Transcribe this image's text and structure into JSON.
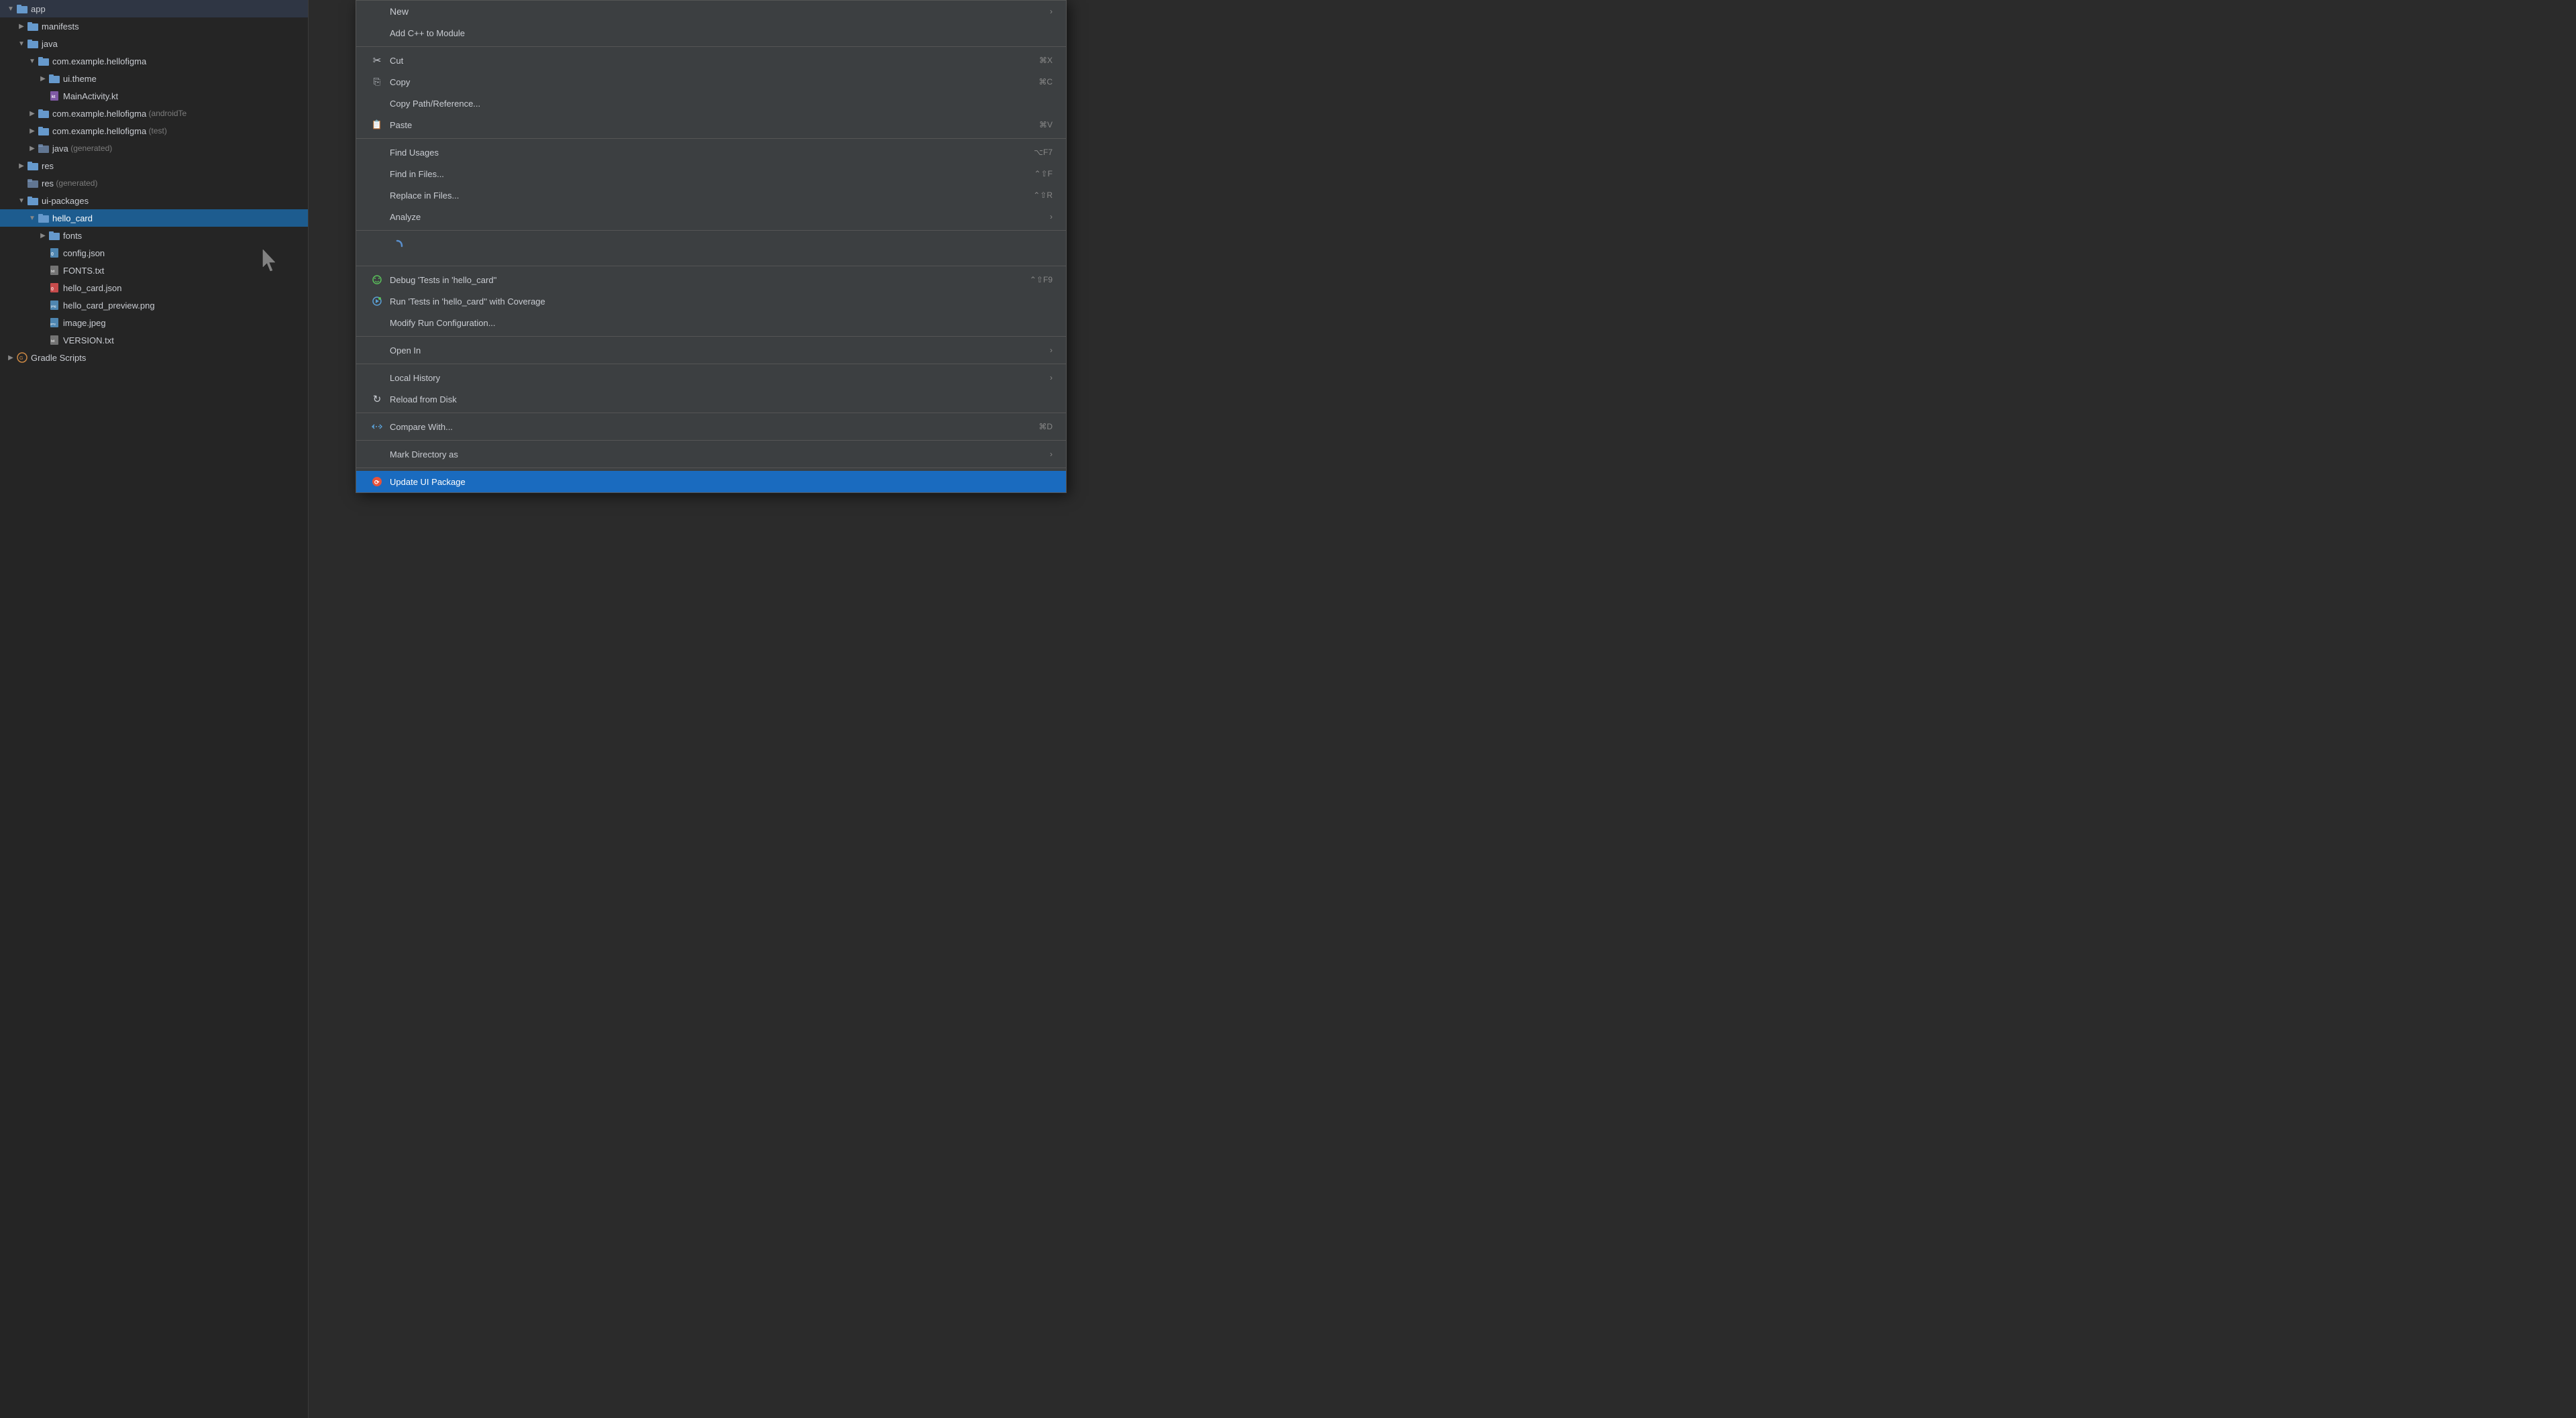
{
  "fileTree": {
    "items": [
      {
        "id": "app",
        "label": "app",
        "indent": 0,
        "type": "folder",
        "arrow": "expanded",
        "iconColor": "blue",
        "selected": false
      },
      {
        "id": "manifests",
        "label": "manifests",
        "indent": 1,
        "type": "folder",
        "arrow": "collapsed",
        "iconColor": "blue",
        "selected": false
      },
      {
        "id": "java",
        "label": "java",
        "indent": 1,
        "type": "folder",
        "arrow": "expanded",
        "iconColor": "blue",
        "selected": false
      },
      {
        "id": "com.example.hellofigma",
        "label": "com.example.hellofigma",
        "indent": 2,
        "type": "folder",
        "arrow": "expanded",
        "iconColor": "blue",
        "selected": false
      },
      {
        "id": "ui.theme",
        "label": "ui.theme",
        "indent": 3,
        "type": "folder",
        "arrow": "collapsed",
        "iconColor": "blue",
        "selected": false
      },
      {
        "id": "MainActivity.kt",
        "label": "MainActivity.kt",
        "indent": 3,
        "type": "file-kt",
        "arrow": "empty",
        "selected": false
      },
      {
        "id": "com.example.hellofigma-androidTest",
        "label": "com.example.hellofigma",
        "suffix": "(androidTe",
        "indent": 2,
        "type": "folder",
        "arrow": "collapsed",
        "iconColor": "blue",
        "selected": false
      },
      {
        "id": "com.example.hellofigma-test",
        "label": "com.example.hellofigma",
        "suffix": "(test)",
        "indent": 2,
        "type": "folder",
        "arrow": "collapsed",
        "iconColor": "blue",
        "selected": false
      },
      {
        "id": "java-generated",
        "label": "java",
        "suffix": "(generated)",
        "indent": 2,
        "type": "folder-generated",
        "arrow": "collapsed",
        "iconColor": "blue",
        "selected": false
      },
      {
        "id": "res",
        "label": "res",
        "indent": 1,
        "type": "folder",
        "arrow": "collapsed",
        "iconColor": "blue",
        "selected": false
      },
      {
        "id": "res-generated",
        "label": "res",
        "suffix": "(generated)",
        "indent": 1,
        "type": "folder-generated",
        "arrow": "empty",
        "iconColor": "blue",
        "selected": false
      },
      {
        "id": "ui-packages",
        "label": "ui-packages",
        "indent": 1,
        "type": "folder",
        "arrow": "expanded",
        "iconColor": "blue",
        "selected": false
      },
      {
        "id": "hello_card",
        "label": "hello_card",
        "indent": 2,
        "type": "folder",
        "arrow": "expanded",
        "iconColor": "blue",
        "selected": true
      },
      {
        "id": "fonts",
        "label": "fonts",
        "indent": 3,
        "type": "folder",
        "arrow": "collapsed",
        "iconColor": "blue",
        "selected": false
      },
      {
        "id": "config.json",
        "label": "config.json",
        "indent": 3,
        "type": "file-json-blue",
        "arrow": "empty",
        "selected": false
      },
      {
        "id": "FONTS.txt",
        "label": "FONTS.txt",
        "indent": 3,
        "type": "file-txt",
        "arrow": "empty",
        "selected": false
      },
      {
        "id": "hello_card.json",
        "label": "hello_card.json",
        "indent": 3,
        "type": "file-json-red",
        "arrow": "empty",
        "selected": false
      },
      {
        "id": "hello_card_preview.png",
        "label": "hello_card_preview.png",
        "indent": 3,
        "type": "file-png",
        "arrow": "empty",
        "selected": false
      },
      {
        "id": "image.jpeg",
        "label": "image.jpeg",
        "indent": 3,
        "type": "file-jpeg",
        "arrow": "empty",
        "selected": false
      },
      {
        "id": "VERSION.txt",
        "label": "VERSION.txt",
        "indent": 3,
        "type": "file-txt",
        "arrow": "empty",
        "selected": false
      },
      {
        "id": "gradle-scripts",
        "label": "Gradle Scripts",
        "indent": 0,
        "type": "gradle",
        "arrow": "collapsed",
        "selected": false
      }
    ]
  },
  "contextMenu": {
    "items": [
      {
        "id": "new",
        "label": "New",
        "icon": "",
        "shortcut": "",
        "hasSubmenu": true,
        "type": "item",
        "section": 1
      },
      {
        "id": "add-cpp",
        "label": "Add C++ to Module",
        "icon": "",
        "shortcut": "",
        "hasSubmenu": false,
        "type": "item",
        "section": 1
      },
      {
        "id": "sep1",
        "type": "separator"
      },
      {
        "id": "cut",
        "label": "Cut",
        "icon": "scissors",
        "shortcut": "⌘X",
        "hasSubmenu": false,
        "type": "item",
        "section": 2
      },
      {
        "id": "copy",
        "label": "Copy",
        "icon": "copy",
        "shortcut": "⌘C",
        "hasSubmenu": false,
        "type": "item",
        "section": 2
      },
      {
        "id": "copy-path",
        "label": "Copy Path/Reference...",
        "icon": "",
        "shortcut": "",
        "hasSubmenu": false,
        "type": "item",
        "section": 2
      },
      {
        "id": "paste",
        "label": "Paste",
        "icon": "paste",
        "shortcut": "⌘V",
        "hasSubmenu": false,
        "type": "item",
        "section": 2
      },
      {
        "id": "sep2",
        "type": "separator"
      },
      {
        "id": "find-usages",
        "label": "Find Usages",
        "icon": "",
        "shortcut": "⌥F7",
        "hasSubmenu": false,
        "type": "item",
        "section": 3
      },
      {
        "id": "find-in-files",
        "label": "Find in Files...",
        "icon": "",
        "shortcut": "⌃⇧F",
        "hasSubmenu": false,
        "type": "item",
        "section": 3
      },
      {
        "id": "replace-in-files",
        "label": "Replace in Files...",
        "icon": "",
        "shortcut": "⌃⇧R",
        "hasSubmenu": false,
        "type": "item",
        "section": 3
      },
      {
        "id": "analyze",
        "label": "Analyze",
        "icon": "",
        "shortcut": "",
        "hasSubmenu": true,
        "type": "item",
        "section": 3
      },
      {
        "id": "sep3",
        "type": "separator"
      },
      {
        "id": "spinner",
        "type": "spinner"
      },
      {
        "id": "sep4",
        "type": "separator"
      },
      {
        "id": "debug-tests",
        "label": "Debug 'Tests in 'hello_card''",
        "icon": "debug",
        "shortcut": "⌃⇧F9",
        "hasSubmenu": false,
        "type": "item",
        "section": 5
      },
      {
        "id": "run-tests-coverage",
        "label": "Run 'Tests in 'hello_card'' with Coverage",
        "icon": "run-coverage",
        "shortcut": "",
        "hasSubmenu": false,
        "type": "item",
        "section": 5
      },
      {
        "id": "modify-run",
        "label": "Modify Run Configuration...",
        "icon": "",
        "shortcut": "",
        "hasSubmenu": false,
        "type": "item",
        "section": 5
      },
      {
        "id": "sep5",
        "type": "separator"
      },
      {
        "id": "open-in",
        "label": "Open In",
        "icon": "",
        "shortcut": "",
        "hasSubmenu": true,
        "type": "item",
        "section": 6
      },
      {
        "id": "sep6",
        "type": "separator"
      },
      {
        "id": "local-history",
        "label": "Local History",
        "icon": "",
        "shortcut": "",
        "hasSubmenu": true,
        "type": "item",
        "section": 7
      },
      {
        "id": "reload-from-disk",
        "label": "Reload from Disk",
        "icon": "reload",
        "shortcut": "",
        "hasSubmenu": false,
        "type": "item",
        "section": 7
      },
      {
        "id": "sep7",
        "type": "separator"
      },
      {
        "id": "compare-with",
        "label": "Compare With...",
        "icon": "compare",
        "shortcut": "⌘D",
        "hasSubmenu": false,
        "type": "item",
        "section": 8
      },
      {
        "id": "sep8",
        "type": "separator"
      },
      {
        "id": "mark-directory-as",
        "label": "Mark Directory as",
        "icon": "",
        "shortcut": "",
        "hasSubmenu": true,
        "type": "item",
        "section": 9
      },
      {
        "id": "sep9",
        "type": "separator"
      },
      {
        "id": "update-ui-package",
        "label": "Update UI Package",
        "icon": "update",
        "shortcut": "",
        "hasSubmenu": false,
        "type": "item",
        "section": 10,
        "highlighted": true
      }
    ]
  },
  "icons": {
    "folder": "📁",
    "scissors": "✂",
    "copy_icon": "⎘",
    "paste_icon": "📋",
    "reload": "↻",
    "compare": "⇄",
    "debug": "🐛",
    "run_coverage": "▶",
    "update": "🔄"
  }
}
